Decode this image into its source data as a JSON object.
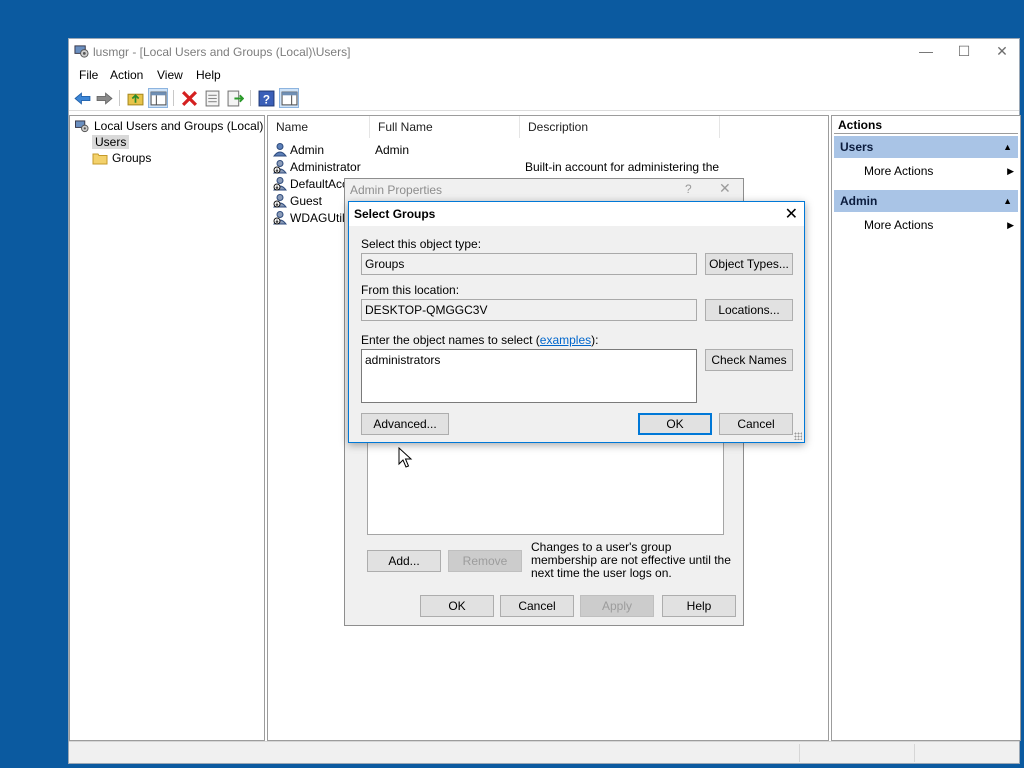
{
  "window": {
    "title": "lusmgr - [Local Users and Groups (Local)\\Users]",
    "controls": {
      "minimize": "—",
      "maximize": "☐",
      "close": "✕"
    }
  },
  "menu": [
    "File",
    "Action",
    "View",
    "Help"
  ],
  "toolbar_icons": [
    "back-icon",
    "forward-icon",
    "up-folder-icon",
    "show-hide-tree-icon",
    "delete-icon",
    "properties-icon",
    "export-list-icon",
    "help-icon",
    "show-hide-action-pane-icon"
  ],
  "tree": {
    "root": "Local Users and Groups (Local)",
    "children": [
      "Users",
      "Groups"
    ]
  },
  "list": {
    "columns": [
      "Name",
      "Full Name",
      "Description"
    ],
    "rows": [
      {
        "name": "Admin",
        "full_name": "Admin",
        "description": ""
      },
      {
        "name": "Administrator",
        "full_name": "",
        "description": "Built-in account for administering the c..."
      },
      {
        "name": "DefaultAcc",
        "full_name": "",
        "description": ""
      },
      {
        "name": "Guest",
        "full_name": "",
        "description": ""
      },
      {
        "name": "WDAGUtilit",
        "full_name": "",
        "description": ""
      }
    ]
  },
  "actions": {
    "title": "Actions",
    "sections": [
      {
        "header": "Users",
        "item": "More Actions"
      },
      {
        "header": "Admin",
        "item": "More Actions"
      }
    ]
  },
  "admin_properties": {
    "title": "Admin Properties",
    "help_glyph": "?",
    "close_glyph": "✕",
    "add_label": "Add...",
    "remove_label": "Remove",
    "note": "Changes to a user's group membership are not effective until the next time the user logs on.",
    "ok_label": "OK",
    "cancel_label": "Cancel",
    "apply_label": "Apply",
    "help_label": "Help"
  },
  "select_groups": {
    "title": "Select Groups",
    "object_type_label": "Select this object type:",
    "object_type_value": "Groups",
    "object_types_button": "Object Types...",
    "location_label": "From this location:",
    "location_value": "DESKTOP-QMGGC3V",
    "locations_button": "Locations...",
    "names_label_prefix": "Enter the object names to select (",
    "names_label_link": "examples",
    "names_label_suffix": "):",
    "names_value": "administrators",
    "check_names_button": "Check Names",
    "advanced_button": "Advanced...",
    "ok_button": "OK",
    "cancel_button": "Cancel"
  },
  "colors": {
    "desktop": "#0b5aa0",
    "selection_accent": "#0078d7",
    "actions_header": "#a9c4e6",
    "link": "#0066cc"
  }
}
